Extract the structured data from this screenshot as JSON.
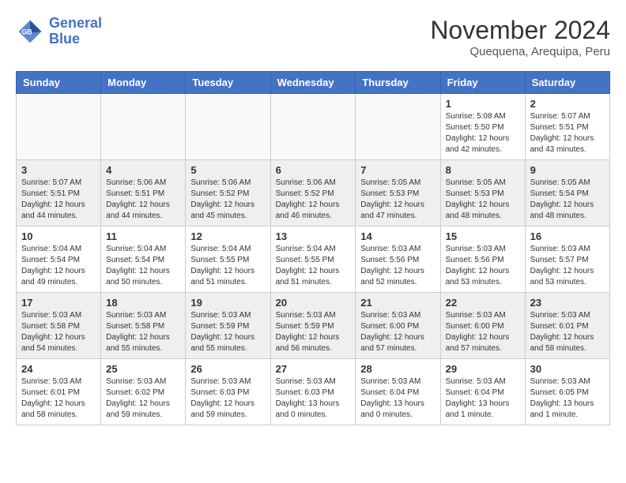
{
  "header": {
    "logo_line1": "General",
    "logo_line2": "Blue",
    "month": "November 2024",
    "location": "Quequena, Arequipa, Peru"
  },
  "days_of_week": [
    "Sunday",
    "Monday",
    "Tuesday",
    "Wednesday",
    "Thursday",
    "Friday",
    "Saturday"
  ],
  "weeks": [
    [
      {
        "day": "",
        "info": ""
      },
      {
        "day": "",
        "info": ""
      },
      {
        "day": "",
        "info": ""
      },
      {
        "day": "",
        "info": ""
      },
      {
        "day": "",
        "info": ""
      },
      {
        "day": "1",
        "info": "Sunrise: 5:08 AM\nSunset: 5:50 PM\nDaylight: 12 hours\nand 42 minutes."
      },
      {
        "day": "2",
        "info": "Sunrise: 5:07 AM\nSunset: 5:51 PM\nDaylight: 12 hours\nand 43 minutes."
      }
    ],
    [
      {
        "day": "3",
        "info": "Sunrise: 5:07 AM\nSunset: 5:51 PM\nDaylight: 12 hours\nand 44 minutes."
      },
      {
        "day": "4",
        "info": "Sunrise: 5:06 AM\nSunset: 5:51 PM\nDaylight: 12 hours\nand 44 minutes."
      },
      {
        "day": "5",
        "info": "Sunrise: 5:06 AM\nSunset: 5:52 PM\nDaylight: 12 hours\nand 45 minutes."
      },
      {
        "day": "6",
        "info": "Sunrise: 5:06 AM\nSunset: 5:52 PM\nDaylight: 12 hours\nand 46 minutes."
      },
      {
        "day": "7",
        "info": "Sunrise: 5:05 AM\nSunset: 5:53 PM\nDaylight: 12 hours\nand 47 minutes."
      },
      {
        "day": "8",
        "info": "Sunrise: 5:05 AM\nSunset: 5:53 PM\nDaylight: 12 hours\nand 48 minutes."
      },
      {
        "day": "9",
        "info": "Sunrise: 5:05 AM\nSunset: 5:54 PM\nDaylight: 12 hours\nand 48 minutes."
      }
    ],
    [
      {
        "day": "10",
        "info": "Sunrise: 5:04 AM\nSunset: 5:54 PM\nDaylight: 12 hours\nand 49 minutes."
      },
      {
        "day": "11",
        "info": "Sunrise: 5:04 AM\nSunset: 5:54 PM\nDaylight: 12 hours\nand 50 minutes."
      },
      {
        "day": "12",
        "info": "Sunrise: 5:04 AM\nSunset: 5:55 PM\nDaylight: 12 hours\nand 51 minutes."
      },
      {
        "day": "13",
        "info": "Sunrise: 5:04 AM\nSunset: 5:55 PM\nDaylight: 12 hours\nand 51 minutes."
      },
      {
        "day": "14",
        "info": "Sunrise: 5:03 AM\nSunset: 5:56 PM\nDaylight: 12 hours\nand 52 minutes."
      },
      {
        "day": "15",
        "info": "Sunrise: 5:03 AM\nSunset: 5:56 PM\nDaylight: 12 hours\nand 53 minutes."
      },
      {
        "day": "16",
        "info": "Sunrise: 5:03 AM\nSunset: 5:57 PM\nDaylight: 12 hours\nand 53 minutes."
      }
    ],
    [
      {
        "day": "17",
        "info": "Sunrise: 5:03 AM\nSunset: 5:58 PM\nDaylight: 12 hours\nand 54 minutes."
      },
      {
        "day": "18",
        "info": "Sunrise: 5:03 AM\nSunset: 5:58 PM\nDaylight: 12 hours\nand 55 minutes."
      },
      {
        "day": "19",
        "info": "Sunrise: 5:03 AM\nSunset: 5:59 PM\nDaylight: 12 hours\nand 55 minutes."
      },
      {
        "day": "20",
        "info": "Sunrise: 5:03 AM\nSunset: 5:59 PM\nDaylight: 12 hours\nand 56 minutes."
      },
      {
        "day": "21",
        "info": "Sunrise: 5:03 AM\nSunset: 6:00 PM\nDaylight: 12 hours\nand 57 minutes."
      },
      {
        "day": "22",
        "info": "Sunrise: 5:03 AM\nSunset: 6:00 PM\nDaylight: 12 hours\nand 57 minutes."
      },
      {
        "day": "23",
        "info": "Sunrise: 5:03 AM\nSunset: 6:01 PM\nDaylight: 12 hours\nand 58 minutes."
      }
    ],
    [
      {
        "day": "24",
        "info": "Sunrise: 5:03 AM\nSunset: 6:01 PM\nDaylight: 12 hours\nand 58 minutes."
      },
      {
        "day": "25",
        "info": "Sunrise: 5:03 AM\nSunset: 6:02 PM\nDaylight: 12 hours\nand 59 minutes."
      },
      {
        "day": "26",
        "info": "Sunrise: 5:03 AM\nSunset: 6:03 PM\nDaylight: 12 hours\nand 59 minutes."
      },
      {
        "day": "27",
        "info": "Sunrise: 5:03 AM\nSunset: 6:03 PM\nDaylight: 13 hours\nand 0 minutes."
      },
      {
        "day": "28",
        "info": "Sunrise: 5:03 AM\nSunset: 6:04 PM\nDaylight: 13 hours\nand 0 minutes."
      },
      {
        "day": "29",
        "info": "Sunrise: 5:03 AM\nSunset: 6:04 PM\nDaylight: 13 hours\nand 1 minute."
      },
      {
        "day": "30",
        "info": "Sunrise: 5:03 AM\nSunset: 6:05 PM\nDaylight: 13 hours\nand 1 minute."
      }
    ]
  ]
}
